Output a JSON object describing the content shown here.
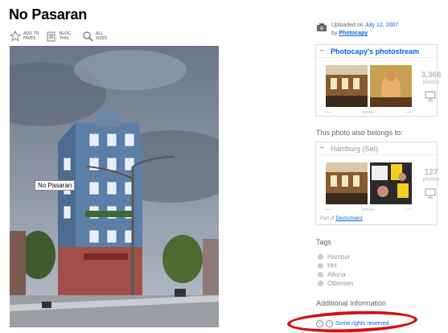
{
  "page": {
    "title": "No Pasaran"
  },
  "toolbar": {
    "fave": "ADD TO FAVES",
    "blog": "BLOG THIS",
    "sizes": "ALL SIZES"
  },
  "photo": {
    "note": "No Pasaran"
  },
  "uploader": {
    "prefix": "Uploaded on",
    "date": "July 12, 2007",
    "by": "by",
    "user": "Photocapy"
  },
  "photostream": {
    "title": "Photocapy's photostream",
    "count": "3,366",
    "unit": "photos",
    "browse": "browse"
  },
  "belongs_label": "This photo also belongs to:",
  "set": {
    "title": "Hamburg (Set)",
    "count": "127",
    "unit": "photos",
    "browse": "browse",
    "partof_prefix": "Part of",
    "partof_link": "Deutschland"
  },
  "tags": {
    "heading": "Tags",
    "items": [
      "Hambur",
      "HH",
      "Altona",
      "Ottensen"
    ]
  },
  "additional": {
    "heading": "Additional Information",
    "rights": "Some rights reserved"
  },
  "colors": {
    "link": "#0063dc",
    "highlight": "#d40f14"
  }
}
